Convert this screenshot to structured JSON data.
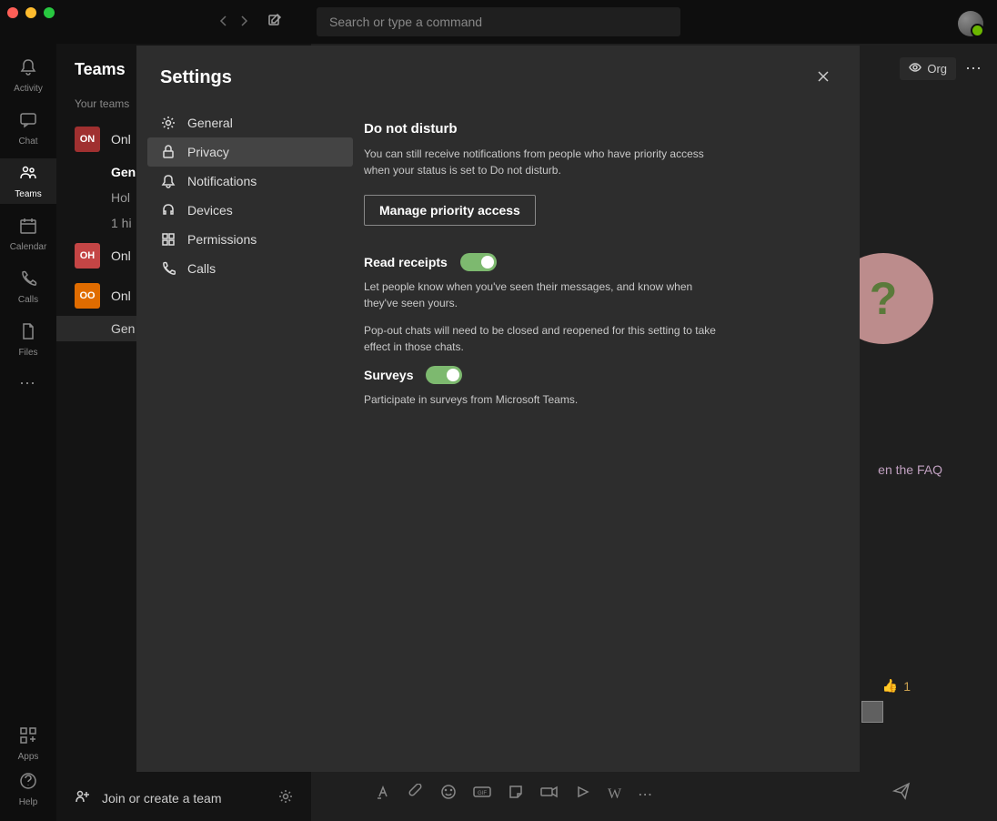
{
  "title_bar": {
    "search_placeholder": "Search or type a command"
  },
  "left_rail": {
    "items": [
      {
        "label": "Activity"
      },
      {
        "label": "Chat"
      },
      {
        "label": "Teams"
      },
      {
        "label": "Calendar"
      },
      {
        "label": "Calls"
      },
      {
        "label": "Files"
      }
    ],
    "bottom": [
      {
        "label": "Apps"
      },
      {
        "label": "Help"
      }
    ]
  },
  "teams_panel": {
    "header": "Teams",
    "your_teams": "Your teams",
    "teams": {
      "t0": {
        "badge": "ON",
        "name": "Onl"
      },
      "t1": {
        "badge": "OH",
        "name": "Onl"
      },
      "t2": {
        "badge": "OO",
        "name": "Onl"
      }
    },
    "channels": {
      "c0": "Gen",
      "c1": "Hol",
      "c2": "1 hi",
      "c3": "Gen"
    },
    "join_label": "Join or create a team"
  },
  "top_right": {
    "org_label": "Org"
  },
  "main": {
    "faq_text": "en the FAQ",
    "thumbs_count": "1"
  },
  "modal": {
    "title": "Settings",
    "nav": {
      "general": "General",
      "privacy": "Privacy",
      "notifications": "Notifications",
      "devices": "Devices",
      "permissions": "Permissions",
      "calls": "Calls"
    },
    "dnd": {
      "heading": "Do not disturb",
      "text": "You can still receive notifications from people who have priority access when your status is set to Do not disturb.",
      "button": "Manage priority access"
    },
    "read_receipts": {
      "heading": "Read receipts",
      "text1": "Let people know when you've seen their messages, and know when they've seen yours.",
      "text2": "Pop-out chats will need to be closed and reopened for this setting to take effect in those chats."
    },
    "surveys": {
      "heading": "Surveys",
      "text": "Participate in surveys from Microsoft Teams."
    }
  }
}
